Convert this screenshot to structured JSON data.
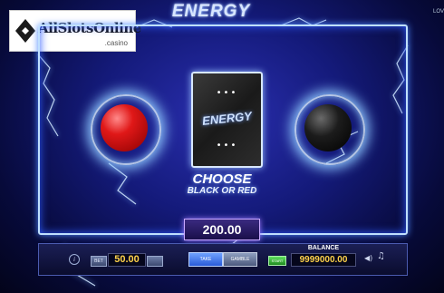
{
  "logo": {
    "text": "AllSlotsOnline",
    "sub": ".casino"
  },
  "game_title": "ENERGY",
  "corner_label": "LOV",
  "card": {
    "dots_top": "•••",
    "dots_bottom": "•••",
    "text": "ENERGY"
  },
  "prompt": {
    "line1": "CHOOSE",
    "line2": "BLACK OR RED"
  },
  "win_amount": "200.00",
  "controls": {
    "info": "i",
    "bet_label": "BET",
    "bet_value": "50.00",
    "take_label": "TAKE",
    "gamble_label": "GAMBLE",
    "start_label": "START",
    "balance_label": "BALANCE",
    "balance_value": "9999000.00",
    "speaker_icon": "◀)",
    "music_icon": "♫"
  },
  "colors": {
    "red_choice": "#e01818",
    "black_choice": "#1c1c1c",
    "accent_glow": "#8ec8ff",
    "value_text": "#ffd34a"
  }
}
